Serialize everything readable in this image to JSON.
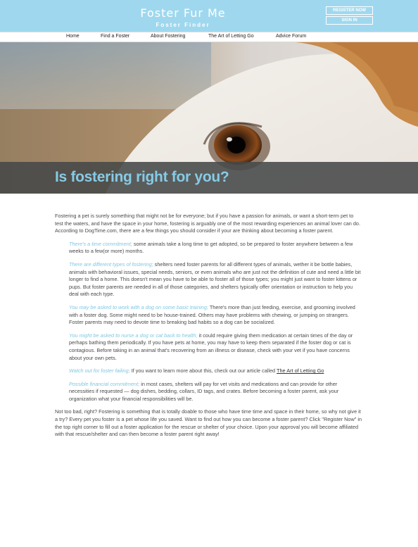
{
  "header": {
    "site_name": "Foster Fur Me",
    "tagline": "Foster Finder",
    "register_label": "REGISTER NOW",
    "signin_label": "SIGN IN"
  },
  "nav": {
    "items": [
      {
        "label": "Home"
      },
      {
        "label": "Find a Foster"
      },
      {
        "label": "About Fostering"
      },
      {
        "label": "The Art of Letting Go"
      },
      {
        "label": "Advice Forum"
      }
    ]
  },
  "hero": {
    "title": "Is fostering right for you?"
  },
  "article": {
    "intro": "Fostering a pet is surely something that might not be for everyone; but if you have a passion for animals, or want a short-term pet to test the waters, and have the space in your home, fostering is arguably one of the most rewarding experiences an animal lover can do. According to DogTime.com, there are a few things you should consider if your are thinking about becoming a foster parent.",
    "tips": [
      {
        "lead": "There's a time commitment;",
        "text": " some animals take a long time to get adopted, so be prepared to foster anywhere between a few weeks to a few(or more) months."
      },
      {
        "lead": "There are different types of fostering;",
        "text": " shelters need foster parents for all different types of animals, wether it be bottle babies, animals with behavioral issues, special needs, seniors, or even animals who are just not the definition of cute and need a little bit longer to find a home. This doesn't mean you have to be able to foster all of those types; you might just want to foster kittens or pups. But foster parents are needed in all of those categories, and shelters typically offer orientation or instruction to help you deal with each type."
      },
      {
        "lead": "You may be asked to work with a dog on some basic training;",
        "text": " There's more than just feeding, exercise, and grooming involved with a foster dog. Some might need to be house-trained. Others may have problems with chewing, or jumping on strangers. Foster parents may need to devote time to breaking bad habits so a dog can be socialized."
      },
      {
        "lead": "You might be asked to nurse a dog or cat back to health;",
        "text": " it could require giving them medication at certain times of the day or perhaps bathing them periodically. If you have pets at home, you may have to keep them separated if the foster dog or cat is contagious. Before taking in an animal that's recovering from an illness or disease, check with your vet if you have concerns about your own pets."
      },
      {
        "lead": "Watch out for foster failing;",
        "text": " If you want to learn more about this, check out our article called ",
        "link": "The Art of Letting Go"
      },
      {
        "lead": "Possible financial commitment;",
        "text": " in most cases, shelters will pay for vet visits and medications and can provide for other necessities if requested — dog dishes, bedding, collars, ID tags, and crates. Before becoming a foster parent, ask your organization what your financial responsibilities will be."
      }
    ],
    "outro": "Not too bad, right? Fostering is something that is totally doable to those who have time time and space in their home, so why not give it a try? Every pet you foster is a pet whose life you saved. Want to find out how you can become a foster parent? Click \"Register Now\" in the top right corner to fill out a foster application for the rescue or shelter of your choice. Upon your approval you will become affiliated with that rescue/shelter and can then become a foster parent right away!"
  },
  "colors": {
    "header_bg": "#9fd8ee",
    "accent": "#7fc7e2",
    "title_blue": "#86cbe6",
    "band_gray": "#464848"
  }
}
